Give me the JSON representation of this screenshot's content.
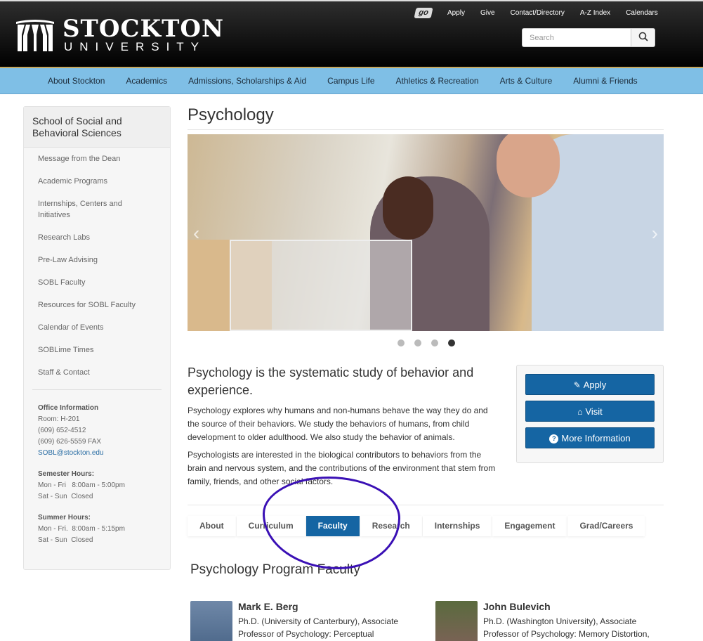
{
  "header": {
    "logo": {
      "primary": "STOCKTON",
      "secondary": "UNIVERSITY"
    },
    "utility_links": [
      "Apply",
      "Give",
      "Contact/Directory",
      "A-Z Index",
      "Calendars"
    ],
    "go_badge": "go",
    "search": {
      "placeholder": "Search",
      "value": "",
      "icon": "search-icon"
    }
  },
  "nav": {
    "items": [
      "About Stockton",
      "Academics",
      "Admissions, Scholarships & Aid",
      "Campus Life",
      "Athletics & Recreation",
      "Arts & Culture",
      "Alumni & Friends"
    ]
  },
  "sidebar": {
    "title": "School of Social and Behavioral Sciences",
    "items": [
      "Message from the Dean",
      "Academic Programs",
      "Internships, Centers and Initiatives",
      "Research Labs",
      "Pre-Law Advising",
      "SOBL Faculty",
      "Resources for SOBL Faculty",
      "Calendar of Events",
      "SOBLime Times",
      "Staff & Contact"
    ],
    "office": {
      "heading": "Office Information",
      "room": "Room: H-201",
      "phone": "(609) 652-4512",
      "fax": "(609) 626-5559 FAX",
      "email": "SOBL@stockton.edu"
    },
    "semester_hours": {
      "heading": "Semester Hours:",
      "weekday": "Mon - Fri   8:00am - 5:00pm",
      "weekend": "Sat - Sun  Closed"
    },
    "summer_hours": {
      "heading": "Summer Hours:",
      "weekday": "Mon - Fri.  8:00am - 5:15pm",
      "weekend": "Sat - Sun  Closed"
    }
  },
  "main": {
    "title": "Psychology",
    "carousel": {
      "slides": 4,
      "active_slide": 4,
      "prev_icon": "chevron-left-icon",
      "next_icon": "chevron-right-icon"
    },
    "lead": "Psychology is the systematic study of behavior and experience.",
    "paragraphs": [
      "Psychology explores why humans and non-humans behave the way they do and the source of their behaviors.  We study the behaviors of humans, from child development to older adulthood. We also study the behavior of animals.",
      "Psychologists are interested in the biological contributors to behaviors from the brain and nervous system, and the contributions of the environment that stem from family, friends, and other social factors."
    ],
    "cta": [
      {
        "label": "Apply",
        "icon": "pencil-icon"
      },
      {
        "label": "Visit",
        "icon": "home-icon"
      },
      {
        "label": "More Information",
        "icon": "question-circle-icon"
      }
    ],
    "tabs": [
      "About",
      "Curriculum",
      "Faculty",
      "Research",
      "Internships",
      "Engagement",
      "Grad/Careers"
    ],
    "active_tab": "Faculty",
    "faculty_heading": "Psychology Program Faculty",
    "faculty": [
      {
        "name": "Mark E. Berg",
        "desc": "Ph.D. (University of Canterbury), Associate Professor of Psychology:  Perceptual"
      },
      {
        "name": "John Bulevich",
        "desc": "Ph.D. (Washington University), Associate Professor of Psychology:  Memory Distortion,"
      }
    ]
  },
  "colors": {
    "nav_bg": "#7fbfe6",
    "accent_blue": "#1565a3",
    "annotation": "#3a10b5"
  }
}
